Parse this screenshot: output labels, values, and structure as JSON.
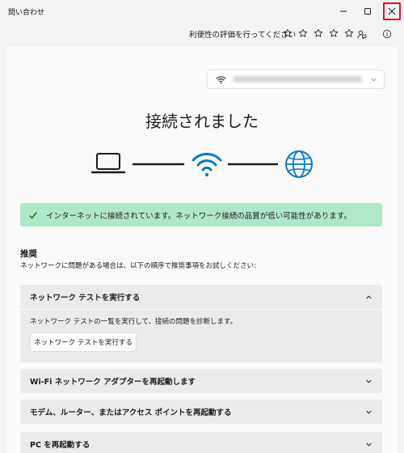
{
  "window": {
    "title": "問い合わせ"
  },
  "rating": {
    "prompt": "利便性の評価を行ってください",
    "star_count": 5
  },
  "network": {
    "name": "••••• •••••••••••• ••••• ••••"
  },
  "status": {
    "headline": "接続されました",
    "banner": "インターネットに接続されています。ネットワーク接続の品質が低い可能性があります。",
    "accent_color": "#0078d4",
    "success_color": "#aee8c9"
  },
  "recommendations": {
    "title": "推奨",
    "description": "ネットワークに問題がある場合は、以下の順序で推奨事項をお試しください:",
    "items": [
      {
        "title": "ネットワーク テストを実行する",
        "expanded": true,
        "description": "ネットワーク テストの一覧を実行して、接続の問題を診断します。",
        "button_label": "ネットワーク テストを実行する"
      },
      {
        "title": "Wi-Fi ネットワーク アダプターを再起動します",
        "expanded": false
      },
      {
        "title": "モデム、ルーター、またはアクセス ポイントを再起動する",
        "expanded": false
      },
      {
        "title": "PC を再起動する",
        "expanded": false
      }
    ]
  },
  "icons": {
    "minimize": "minimize-icon",
    "maximize": "maximize-icon",
    "close": "close-icon",
    "star": "star-outline-icon",
    "feedback": "feedback-icon",
    "info": "info-icon",
    "wifi": "wifi-icon",
    "laptop": "laptop-icon",
    "globe": "globe-icon",
    "check": "checkmark-icon",
    "chevron_up": "chevron-up-icon",
    "chevron_down": "chevron-down-icon"
  }
}
